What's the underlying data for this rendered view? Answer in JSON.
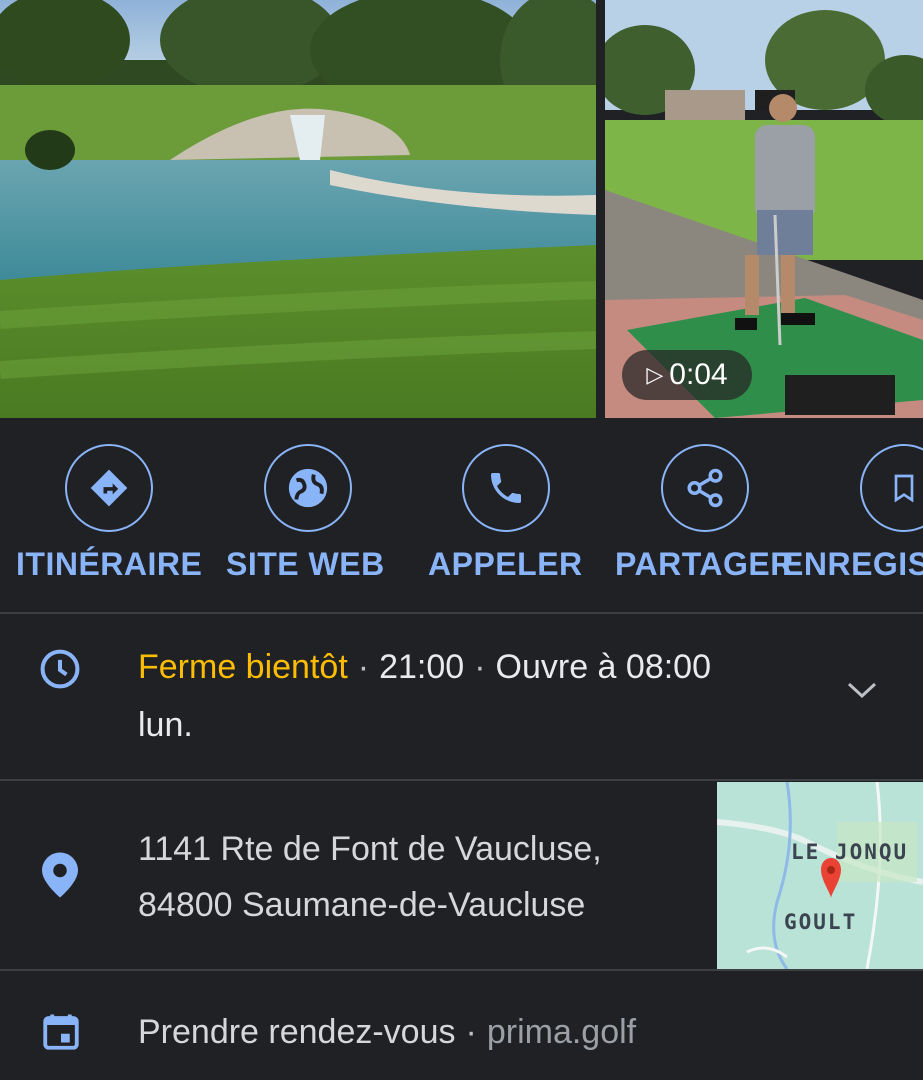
{
  "media": {
    "video_duration": "0:04"
  },
  "actions": [
    {
      "label": "ITINÉRAIRE",
      "icon": "directions-icon"
    },
    {
      "label": "SITE WEB",
      "icon": "globe-icon"
    },
    {
      "label": "APPELER",
      "icon": "phone-icon"
    },
    {
      "label": "PARTAGER",
      "icon": "share-icon"
    },
    {
      "label": "ENREGISTRER",
      "icon": "bookmark-icon"
    }
  ],
  "hours": {
    "status": "Ferme bientôt",
    "close_time": "21:00",
    "next_open": "Ouvre à 08:00",
    "next_day": "lun."
  },
  "address": {
    "line1": "1141 Rte de Font de Vaucluse,",
    "line2": "84800 Saumane-de-Vaucluse",
    "map_labels": [
      "LE JONQU",
      "GOULT"
    ]
  },
  "booking": {
    "label": "Prendre rendez-vous",
    "domain": "prima.golf"
  },
  "colors": {
    "background": "#202124",
    "accent": "#8ab4f8",
    "warning": "#fbbc04",
    "divider": "#3c4043",
    "pin": "#ea4335"
  }
}
